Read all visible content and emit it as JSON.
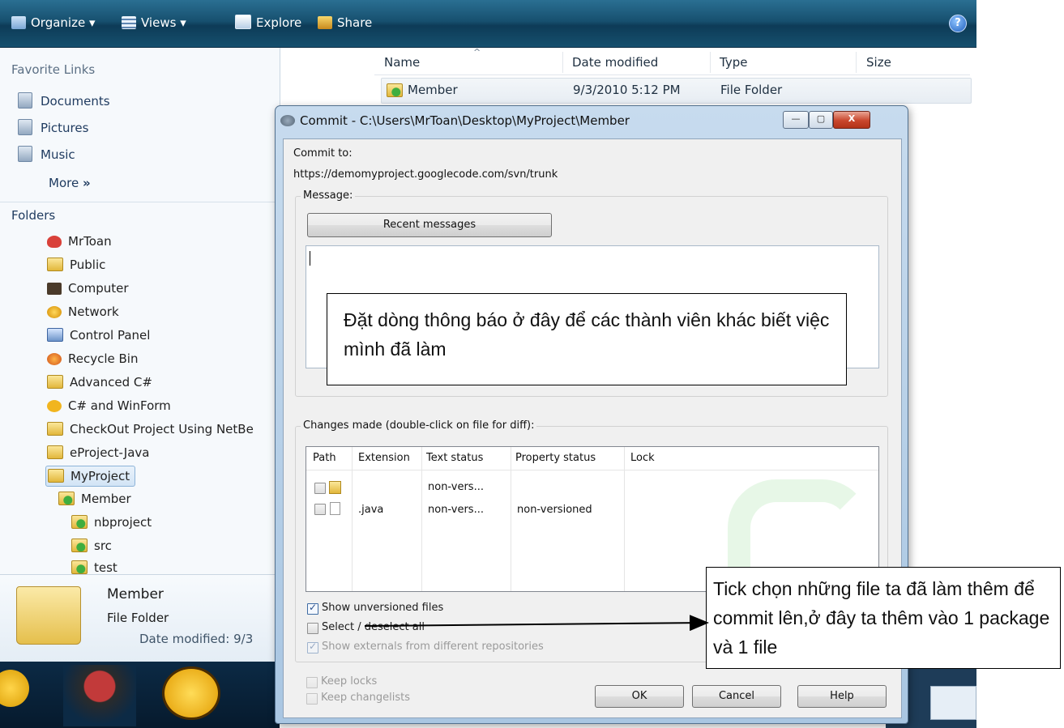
{
  "toolbar": {
    "organize": "Organize",
    "views": "Views",
    "explore": "Explore",
    "share": "Share",
    "help": "?"
  },
  "nav": {
    "favorites_title": "Favorite Links",
    "favorites": [
      "Documents",
      "Pictures",
      "Music"
    ],
    "more": "More",
    "more_arrow": "»",
    "folders_title": "Folders",
    "folders": [
      {
        "label": "MrToan",
        "icon": "user-icon"
      },
      {
        "label": "Public",
        "icon": "folder-icon"
      },
      {
        "label": "Computer",
        "icon": "computer-icon"
      },
      {
        "label": "Network",
        "icon": "network-icon"
      },
      {
        "label": "Control Panel",
        "icon": "control-panel-icon"
      },
      {
        "label": "Recycle Bin",
        "icon": "recycle-bin-icon"
      },
      {
        "label": "Advanced C#",
        "icon": "folder-icon"
      },
      {
        "label": "C# and WinForm",
        "icon": "mail-folder-icon"
      },
      {
        "label": "CheckOut Project Using NetBe",
        "icon": "folder-icon"
      },
      {
        "label": "eProject-Java",
        "icon": "folder-icon"
      },
      {
        "label": "MyProject",
        "icon": "folder-icon"
      },
      {
        "label": "Member",
        "icon": "svn-folder-icon"
      },
      {
        "label": "nbproject",
        "icon": "svn-folder-icon"
      },
      {
        "label": "src",
        "icon": "svn-folder-icon"
      },
      {
        "label": "test",
        "icon": "svn-folder-icon"
      }
    ]
  },
  "details": {
    "name": "Member",
    "type": "File Folder",
    "date_label": "Date modified: 9/3"
  },
  "content": {
    "columns": [
      "Name",
      "Date modified",
      "Type",
      "Size"
    ],
    "rows": [
      {
        "name": "Member",
        "date": "9/3/2010 5:12 PM",
        "type": "File Folder",
        "size": ""
      }
    ]
  },
  "dialog": {
    "title": "Commit - C:\\Users\\MrToan\\Desktop\\MyProject\\Member",
    "commit_to_label": "Commit to:",
    "commit_url": "https://demomyproject.googlecode.com/svn/trunk",
    "message_group": "Message:",
    "recent_messages": "Recent messages",
    "changes_group": "Changes made (double-click on file for diff):",
    "list_columns": [
      "Path",
      "Extension",
      "Text status",
      "Property status",
      "Lock"
    ],
    "list_rows": [
      {
        "extension": "",
        "text_status": "non-vers...",
        "property_status": "",
        "lock": ""
      },
      {
        "extension": ".java",
        "text_status": "non-vers...",
        "property_status": "non-versioned",
        "lock": ""
      }
    ],
    "show_unversioned": "Show unversioned files",
    "select_all": "Select / deselect all",
    "show_externals": "Show externals from different repositories",
    "keep_locks": "Keep locks",
    "keep_changelists": "Keep changelists",
    "ok": "OK",
    "cancel": "Cancel",
    "help": "Help"
  },
  "callouts": {
    "message_hint": "Đặt dòng thông báo ở đây để các thành viên khác biết việc mình đã làm",
    "tick_hint": "Tick chọn những file ta đã làm thêm để commit lên,ở đây ta thêm vào 1 package và 1 file"
  }
}
